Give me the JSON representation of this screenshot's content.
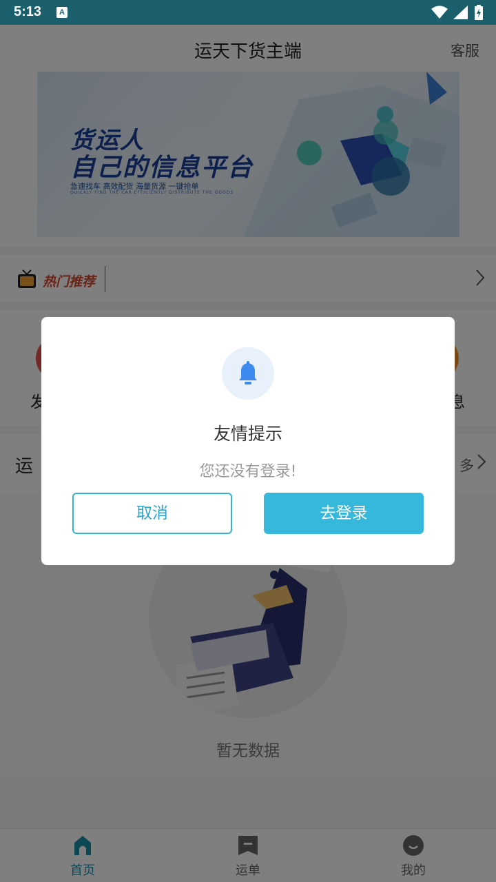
{
  "status_bar": {
    "time": "5:13",
    "notification_icon": "A"
  },
  "header": {
    "title": "运天下货主端",
    "service_label": "客服"
  },
  "banner": {
    "line1": "货运人",
    "line2": "自己的信息平台",
    "tagline": "急速找车 高效配货 海量货源 一键抢单",
    "tagline_en": "QUICKLY FIND THE CAR EFFICIENTLY DISTRIBUTE THE GOODS"
  },
  "hot": {
    "label": "热门推荐"
  },
  "menu": {
    "left_label_partial": "发",
    "right_label_partial": "息"
  },
  "waybill": {
    "title_partial": "运",
    "more_partial": "多"
  },
  "empty": {
    "text": "暂无数据"
  },
  "tabs": [
    {
      "label": "首页",
      "icon": "home-icon",
      "active": true
    },
    {
      "label": "运单",
      "icon": "waybill-icon",
      "active": false
    },
    {
      "label": "我的",
      "icon": "profile-icon",
      "active": false
    }
  ],
  "dialog": {
    "icon": "bell-icon",
    "title": "友情提示",
    "message": "您还没有登录!",
    "cancel_label": "取消",
    "login_label": "去登录"
  },
  "colors": {
    "accent": "#35b8dc",
    "status_bar": "#1b5f6d",
    "tab_active": "#1a8fa6"
  }
}
